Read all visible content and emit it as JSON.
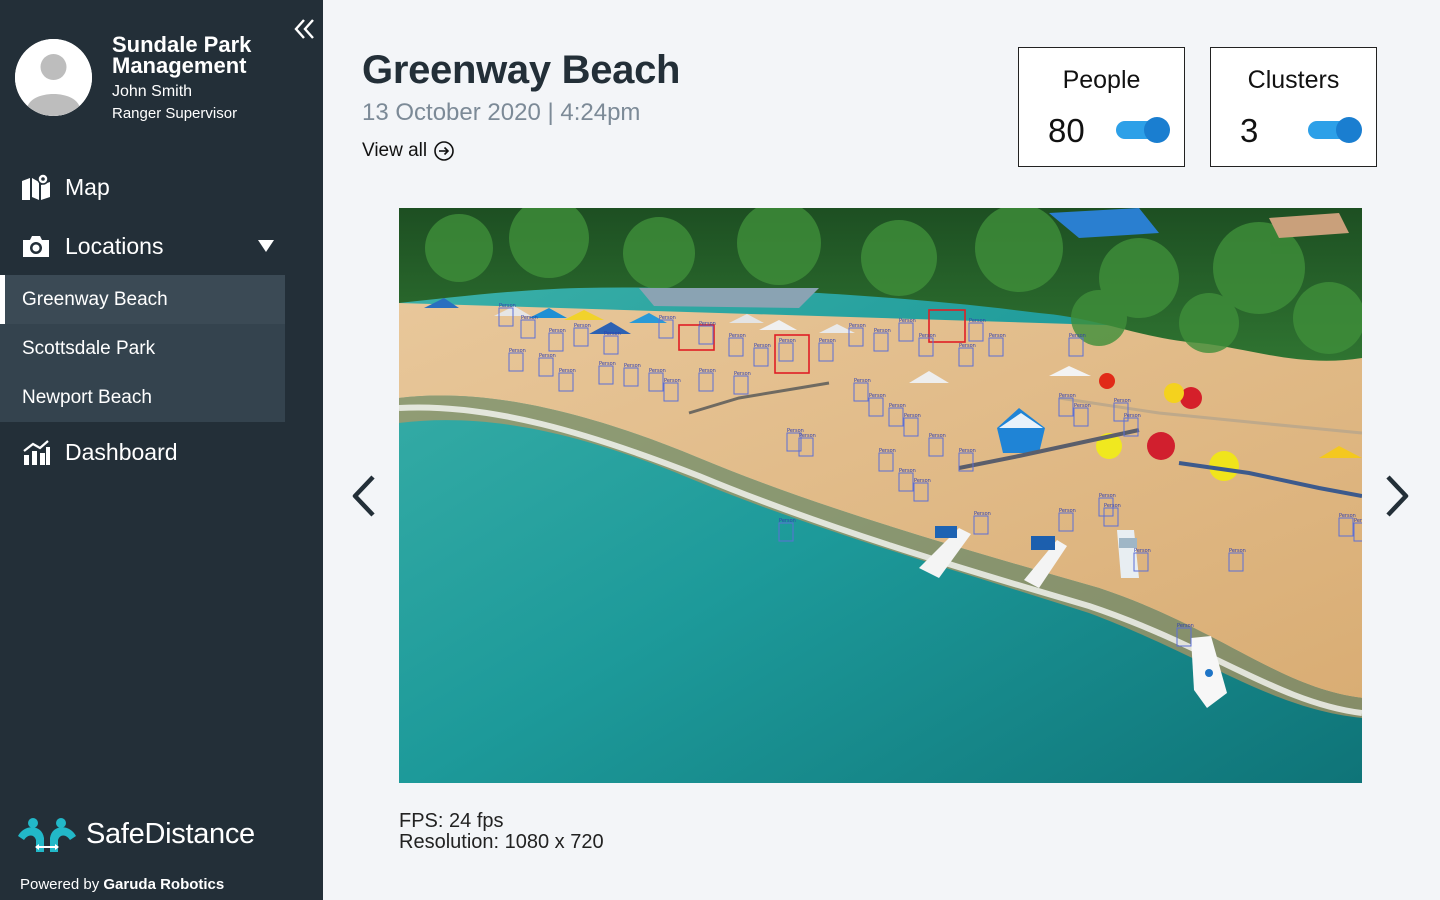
{
  "sidebar": {
    "org_name": "Sundale Park Management",
    "user_name": "John Smith",
    "user_role": "Ranger Supervisor",
    "nav": {
      "map_label": "Map",
      "locations_label": "Locations",
      "dashboard_label": "Dashboard"
    },
    "locations": [
      {
        "label": "Greenway Beach",
        "active": true
      },
      {
        "label": "Scottsdale Park",
        "active": false
      },
      {
        "label": "Newport Beach",
        "active": false
      }
    ],
    "brand": "SafeDistance",
    "powered_prefix": "Powered by",
    "powered_company": "Garuda Robotics"
  },
  "main": {
    "title": "Greenway Beach",
    "subtitle": "13 October 2020 | 4:24pm",
    "view_all": "View all",
    "stats": {
      "people": {
        "label": "People",
        "value": "80",
        "toggle_on": true
      },
      "clusters": {
        "label": "Clusters",
        "value": "3",
        "toggle_on": true
      }
    },
    "detection_label": "Person",
    "fps_text": "FPS: 24 fps",
    "resolution_text": "Resolution: 1080 x 720"
  },
  "colors": {
    "sidebar_bg": "#232f38",
    "submenu_bg": "#34434e",
    "accent": "#2da0e8",
    "brand_teal": "#22b8c8",
    "page_bg": "#f3f5f8"
  },
  "icons": [
    "collapse-icon",
    "map-icon",
    "camera-icon",
    "caret-down-icon",
    "dashboard-icon",
    "arrow-circle-right-icon",
    "chevron-left-icon",
    "chevron-right-icon",
    "safedistance-logo-icon"
  ]
}
